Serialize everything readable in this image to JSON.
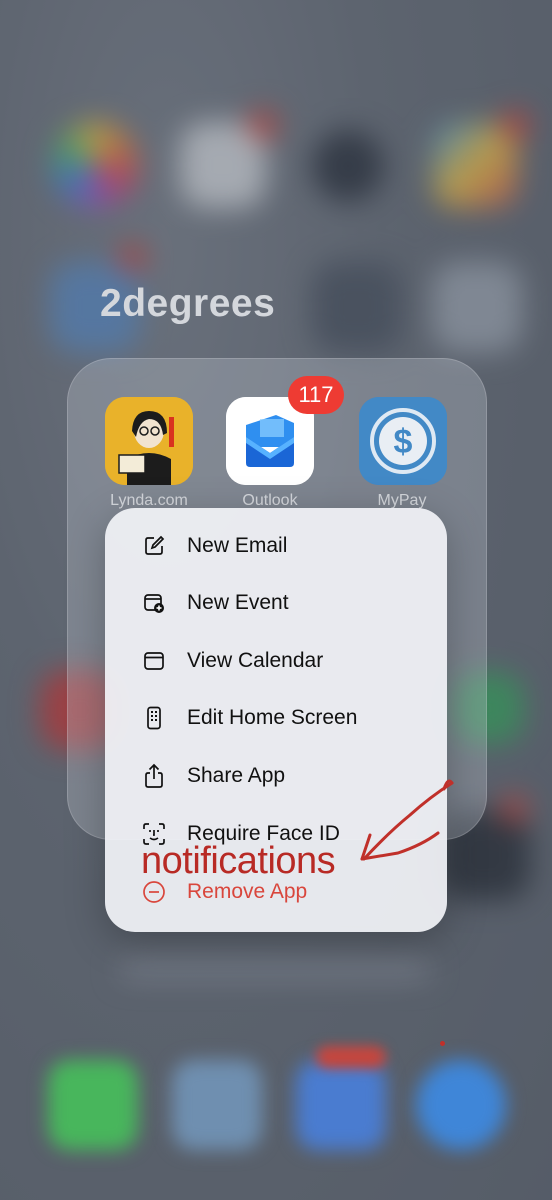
{
  "folder": {
    "title": "2degrees",
    "apps": [
      {
        "label": "Lynda.com",
        "icon": "lynda-icon"
      },
      {
        "label": "Outlook",
        "icon": "outlook-icon",
        "badge": "117"
      },
      {
        "label": "MyPay",
        "icon": "mypay-icon"
      }
    ]
  },
  "menu": {
    "items": [
      {
        "label": "New Email",
        "icon": "compose-icon"
      },
      {
        "label": "New Event",
        "icon": "calendar-add-icon"
      },
      {
        "label": "View Calendar",
        "icon": "calendar-icon"
      },
      {
        "label": "Edit Home Screen",
        "icon": "phone-grid-icon"
      },
      {
        "label": "Share App",
        "icon": "share-icon"
      },
      {
        "label": "Require Face ID",
        "icon": "face-id-icon"
      },
      {
        "label": "Remove App",
        "icon": "minus-circle-icon",
        "destructive": true
      }
    ]
  },
  "annotation": {
    "text": "notifications",
    "color": "#b82a25"
  },
  "colors": {
    "badge": "#ee3b33",
    "destructive": "#d9463c"
  }
}
